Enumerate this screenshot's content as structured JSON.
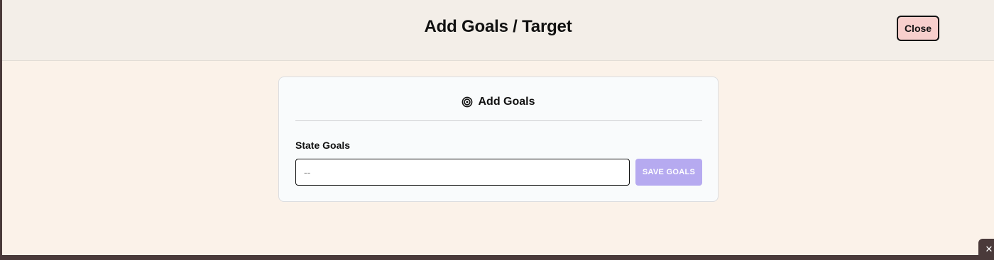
{
  "header": {
    "title": "Add Goals / Target",
    "close_label": "Close"
  },
  "card": {
    "icon": "target-icon",
    "title": "Add Goals",
    "field_label": "State Goals",
    "input": {
      "placeholder": "--",
      "value": ""
    },
    "save_label": "SAVE GOALS"
  },
  "corner": {
    "icon": "close-icon",
    "glyph": "✕"
  },
  "colors": {
    "header_bg": "#f3eee8",
    "page_bg": "#fbf2e9",
    "close_button_bg": "#f7cfcc",
    "save_button_bg": "#b6aaf0",
    "card_bg": "#f9fbfc"
  }
}
